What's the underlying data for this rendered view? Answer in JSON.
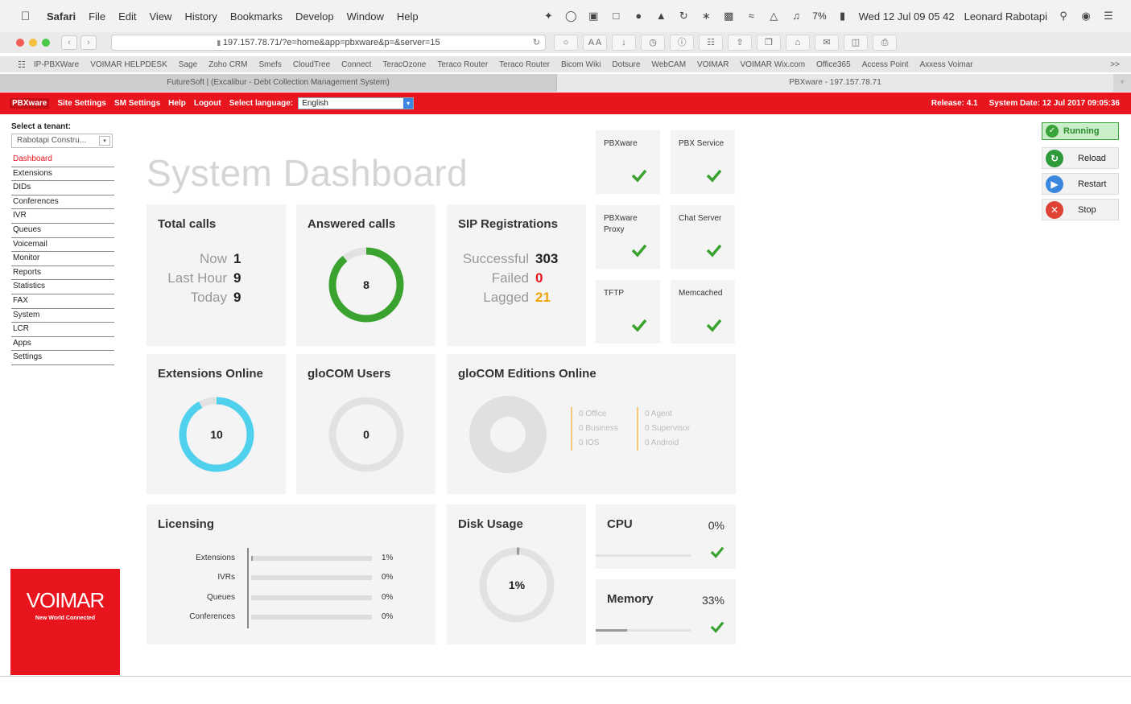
{
  "menubar": {
    "app": "Safari",
    "items": [
      "File",
      "Edit",
      "View",
      "History",
      "Bookmarks",
      "Develop",
      "Window",
      "Help"
    ],
    "battery": "7%",
    "datetime": "Wed 12 Jul  09 05 42",
    "user": "Leonard Rabotapi"
  },
  "browser": {
    "url": "197.157.78.71/?e=home&app=pbxware&p=&server=15",
    "bookmarks": [
      "IP-PBXWare",
      "VOIMAR HELPDESK",
      "Sage",
      "Zoho CRM",
      "Smefs",
      "CloudTree",
      "Connect",
      "TeracOzone",
      "Teraco Router",
      "Teraco Router",
      "Bicom Wiki",
      "Dotsure",
      "WebCAM",
      "VOIMAR",
      "VOIMAR Wix.com",
      "Office365",
      "Access Point",
      "Axxess Voimar"
    ],
    "more": ">>",
    "tabs": [
      "FutureSoft | (Excalibur - Debt Collection Management System)",
      "PBXware - 197.157.78.71"
    ],
    "tab_plus": "+"
  },
  "appbar": {
    "brand": "PBXware",
    "links": [
      "Site Settings",
      "SM Settings",
      "Help",
      "Logout"
    ],
    "lang_label": "Select language:",
    "lang_value": "English",
    "release": "Release: 4.1",
    "system_date": "System Date: 12 Jul 2017 09:05:36"
  },
  "sidebar": {
    "tenant_label": "Select a tenant:",
    "tenant_value": "Rabotapi Constru...",
    "items": [
      "Dashboard",
      "Extensions",
      "DIDs",
      "Conferences",
      "IVR",
      "Queues",
      "Voicemail",
      "Monitor",
      "Reports",
      "Statistics",
      "FAX",
      "System",
      "LCR",
      "Apps",
      "Settings"
    ],
    "active": "Dashboard"
  },
  "dashboard": {
    "title": "System Dashboard",
    "total_calls": {
      "title": "Total calls",
      "rows": [
        {
          "label": "Now",
          "value": "1"
        },
        {
          "label": "Last Hour",
          "value": "9"
        },
        {
          "label": "Today",
          "value": "9"
        }
      ]
    },
    "answered_calls": {
      "title": "Answered calls",
      "value": "8",
      "fraction": 0.89,
      "color": "#3aa32f"
    },
    "sip": {
      "title": "SIP Registrations",
      "rows": [
        {
          "label": "Successful",
          "value": "303",
          "color": "#222"
        },
        {
          "label": "Failed",
          "value": "0",
          "color": "#e8151e"
        },
        {
          "label": "Lagged",
          "value": "21",
          "color": "#f0a400"
        }
      ]
    },
    "services": [
      {
        "label": "PBXware",
        "ok": true
      },
      {
        "label": "PBX Service",
        "ok": true
      },
      {
        "label": "PBXware Proxy",
        "ok": true
      },
      {
        "label": "Chat Server",
        "ok": true
      },
      {
        "label": "TFTP",
        "ok": true
      },
      {
        "label": "Memcached",
        "ok": true
      }
    ],
    "extensions_online": {
      "title": "Extensions Online",
      "value": "10",
      "fraction": 0.92,
      "color": "#4fd0ec"
    },
    "glocom_users": {
      "title": "gloCOM Users",
      "value": "0",
      "fraction": 0
    },
    "glocom_editions": {
      "title": "gloCOM Editions Online",
      "legend_left": [
        "0 Office",
        "0 Business",
        "0 IOS"
      ],
      "legend_right": [
        "0 Agent",
        "0 Supervisor",
        "0 Android"
      ]
    },
    "licensing": {
      "title": "Licensing",
      "rows": [
        {
          "label": "Extensions",
          "pct": "1%",
          "fraction": 0.01
        },
        {
          "label": "IVRs",
          "pct": "0%",
          "fraction": 0
        },
        {
          "label": "Queues",
          "pct": "0%",
          "fraction": 0
        },
        {
          "label": "Conferences",
          "pct": "0%",
          "fraction": 0
        }
      ]
    },
    "disk": {
      "title": "Disk Usage",
      "value": "1%",
      "fraction": 0.01
    },
    "cpu": {
      "title": "CPU",
      "pct": "0%",
      "fraction": 0
    },
    "memory": {
      "title": "Memory",
      "pct": "33%",
      "fraction": 0.33
    }
  },
  "controls": {
    "running": "Running",
    "reload": "Reload",
    "restart": "Restart",
    "stop": "Stop"
  },
  "logo": {
    "name": "VOIMAR",
    "tagline": "New World Connected"
  }
}
